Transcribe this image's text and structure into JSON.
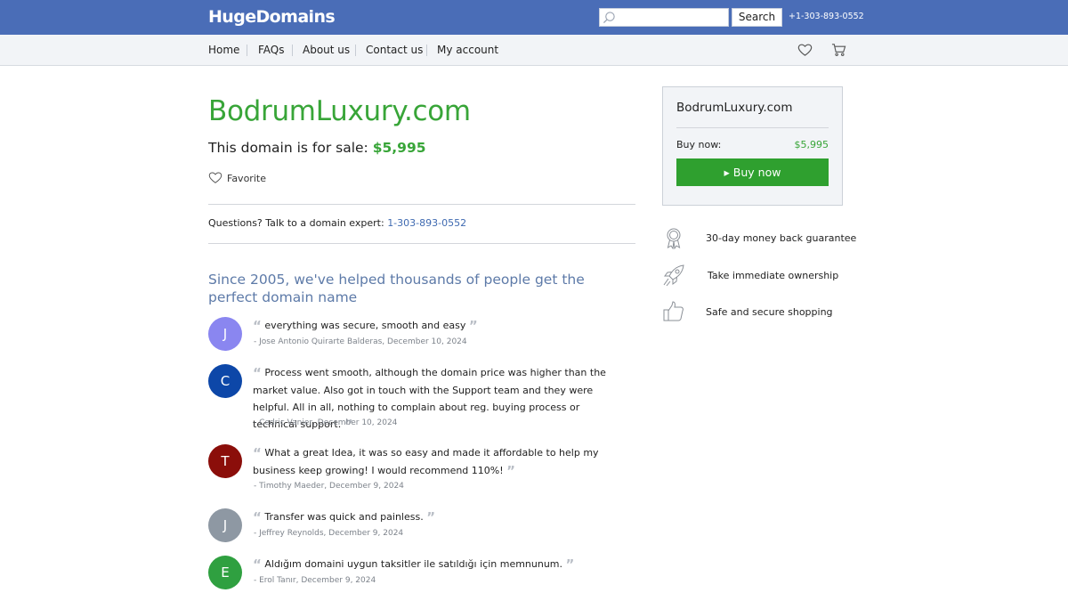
{
  "header": {
    "logo": "HugeDomains",
    "search_placeholder": "",
    "search_button": "Search",
    "phone": "+1-303-893-0552"
  },
  "nav": {
    "items": [
      "Home",
      "FAQs",
      "About us",
      "Contact us",
      "My account"
    ]
  },
  "main": {
    "domain": "BodrumLuxury.com",
    "sale_text": "This domain is for sale:",
    "price": "$5,995",
    "favorite": "Favorite",
    "questions_text": "Questions? Talk to a domain expert:",
    "questions_phone": "1-303-893-0552",
    "since_heading": "Since 2005, we've helped thousands of people get the perfect domain name"
  },
  "reviews": [
    {
      "initial": "J",
      "color": "#8a86f0",
      "text": "everything was secure, smooth and easy",
      "author": "- Jose Antonio Quirarte Balderas, December 10, 2024"
    },
    {
      "initial": "C",
      "color": "#0d47a8",
      "text": "Process went smooth, although the domain price was higher than the market value. Also got in touch with the Support team and they were helpful. All in all, nothing to complain about reg. buying process or technical support.",
      "author": "- Cedric Vanier, December 10, 2024"
    },
    {
      "initial": "T",
      "color": "#8b0e0a",
      "text": "What a great Idea, it was so easy and made it affordable to help my business keep growing! I would recommend 110%!",
      "author": "- Timothy Maeder, December 9, 2024"
    },
    {
      "initial": "J",
      "color": "#8e98a3",
      "text": "Transfer was quick and painless.",
      "author": "- Jeffrey Reynolds, December 9, 2024"
    },
    {
      "initial": "E",
      "color": "#2fa040",
      "text": "Aldığım domaini uygun taksitler ile satıldığı için memnunum.",
      "author": "- Erol Tanır, December 9, 2024"
    }
  ],
  "sidebar": {
    "domain": "BodrumLuxury.com",
    "buy_label": "Buy now:",
    "buy_price": "$5,995",
    "buy_button": "▸ Buy now",
    "features": [
      {
        "icon": "award-ribbon-icon",
        "text": "30-day money back guarantee"
      },
      {
        "icon": "rocket-icon",
        "text": "Take immediate ownership"
      },
      {
        "icon": "thumbs-up-icon",
        "text": "Safe and secure shopping"
      }
    ]
  },
  "colors": {
    "header_blue": "#4a6db7",
    "accent_green": "#38a538",
    "link_blue": "#3f6ab1"
  }
}
